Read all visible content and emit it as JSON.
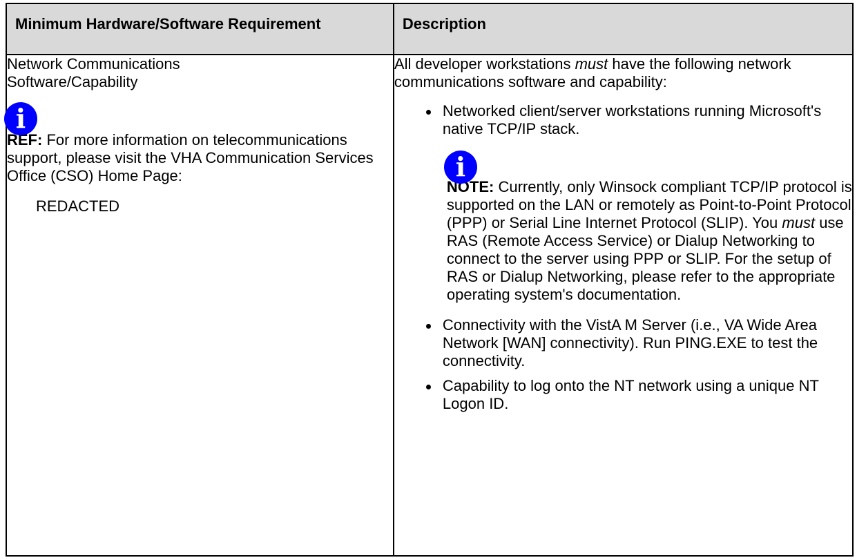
{
  "header": {
    "col1": "Minimum Hardware/Software Requirement",
    "col2": "Description"
  },
  "row": {
    "requirement": "Network Communications Software/Capability",
    "ref_label": "REF:",
    "ref_text": "For more information on telecommunications support, please visit the VHA Communication Services Office (CSO) Home Page:",
    "redacted": "REDACTED",
    "intro_pre": "All developer workstations ",
    "intro_em": "must",
    "intro_post": " have the following network communications software and capability:",
    "bullets": [
      "Networked client/server workstations running Microsoft's native TCP/IP stack.",
      "Connectivity with the VistA M Server (i.e., VA Wide Area Network [WAN] connectivity). Run PING.EXE to test the connectivity.",
      "Capability to log onto the NT network using a unique NT Logon ID."
    ],
    "note_label": "NOTE:",
    "note_pre": "Currently, only Winsock compliant TCP/IP protocol is supported on the LAN or remotely as Point-to-Point Protocol (PPP) or Serial Line Internet Protocol (SLIP). You ",
    "note_em": "must",
    "note_post": " use RAS (Remote Access Service) or Dialup Networking to connect to the server using PPP or SLIP. For the setup of RAS or Dialup Networking, please refer to the appropriate operating system's documentation."
  },
  "icons": {
    "info_icon_glyph": "i",
    "info_icon_color": "#0000ff"
  }
}
